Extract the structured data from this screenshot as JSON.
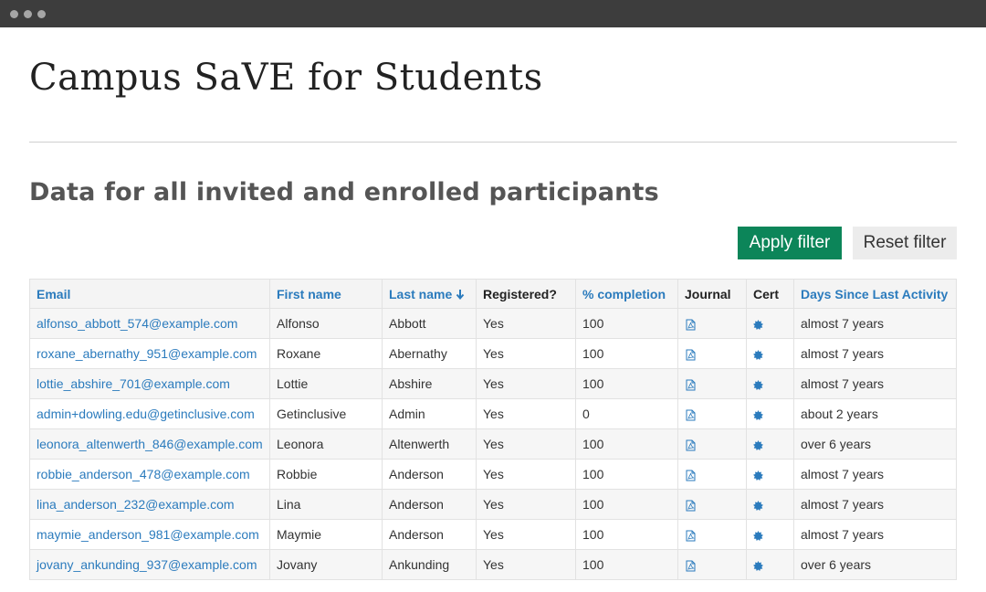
{
  "window": {
    "title": ""
  },
  "page": {
    "title": "Campus SaVE for Students",
    "subtitle": "Data for all invited and enrolled participants"
  },
  "actions": {
    "apply_label": "Apply filter",
    "reset_label": "Reset filter"
  },
  "colors": {
    "accent": "#0c8559",
    "link": "#2b7bbd"
  },
  "table": {
    "columns": [
      {
        "key": "email",
        "label": "Email",
        "sortable": true
      },
      {
        "key": "first",
        "label": "First name",
        "sortable": true
      },
      {
        "key": "last",
        "label": "Last name",
        "sortable": true,
        "sort": "desc",
        "sort_icon": "arrow-down-icon"
      },
      {
        "key": "registered",
        "label": "Registered?",
        "sortable": false
      },
      {
        "key": "completion",
        "label": "% completion",
        "sortable": true
      },
      {
        "key": "journal",
        "label": "Journal",
        "sortable": false
      },
      {
        "key": "cert",
        "label": "Cert",
        "sortable": false
      },
      {
        "key": "days",
        "label": "Days Since Last Activity",
        "sortable": true
      }
    ],
    "rows": [
      {
        "email": "alfonso_abbott_574@example.com",
        "first": "Alfonso",
        "last": "Abbott",
        "registered": "Yes",
        "completion": "100",
        "days": "almost 7 years"
      },
      {
        "email": "roxane_abernathy_951@example.com",
        "first": "Roxane",
        "last": "Abernathy",
        "registered": "Yes",
        "completion": "100",
        "days": "almost 7 years"
      },
      {
        "email": "lottie_abshire_701@example.com",
        "first": "Lottie",
        "last": "Abshire",
        "registered": "Yes",
        "completion": "100",
        "days": "almost 7 years"
      },
      {
        "email": "admin+dowling.edu@getinclusive.com",
        "first": "Getinclusive",
        "last": "Admin",
        "registered": "Yes",
        "completion": "0",
        "days": "about 2 years"
      },
      {
        "email": "leonora_altenwerth_846@example.com",
        "first": "Leonora",
        "last": "Altenwerth",
        "registered": "Yes",
        "completion": "100",
        "days": "over 6 years"
      },
      {
        "email": "robbie_anderson_478@example.com",
        "first": "Robbie",
        "last": "Anderson",
        "registered": "Yes",
        "completion": "100",
        "days": "almost 7 years"
      },
      {
        "email": "lina_anderson_232@example.com",
        "first": "Lina",
        "last": "Anderson",
        "registered": "Yes",
        "completion": "100",
        "days": "almost 7 years"
      },
      {
        "email": "maymie_anderson_981@example.com",
        "first": "Maymie",
        "last": "Anderson",
        "registered": "Yes",
        "completion": "100",
        "days": "almost 7 years"
      },
      {
        "email": "jovany_ankunding_937@example.com",
        "first": "Jovany",
        "last": "Ankunding",
        "registered": "Yes",
        "completion": "100",
        "days": "over 6 years"
      }
    ],
    "journal_icon": "pdf-icon",
    "cert_icon": "certificate-badge-icon"
  }
}
